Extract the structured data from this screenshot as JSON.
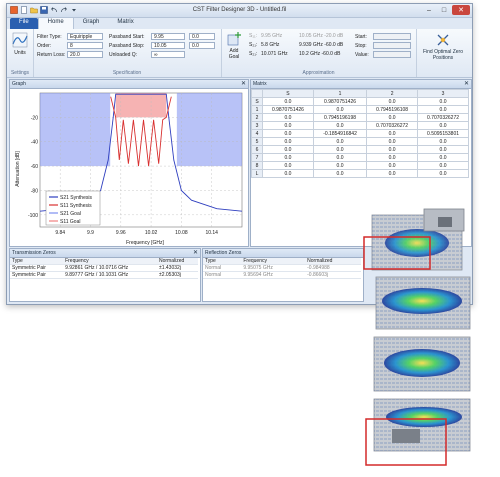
{
  "app": {
    "title": "CST Filter Designer 3D - Untitled.fil",
    "tabs": [
      "File",
      "Home",
      "Graph",
      "Matrix"
    ]
  },
  "ribbon": {
    "units_label": "Units",
    "settings_label": "Settings",
    "spec_label": "Specification",
    "approx_label": "Approximation",
    "filter_type_label": "Filter Type:",
    "filter_type_value": "Equiripple",
    "order_label": "Order:",
    "order_value": "8",
    "return_loss_label": "Return Loss:",
    "return_loss_value": "20.0",
    "pb_start_label": "Passband Start:",
    "pb_start_value": "9.95",
    "pb_stop_label": "Passband Stop:",
    "pb_stop_value": "10.05",
    "unloaded_q_label": "Unloaded Q:",
    "unloaded_q_value": "∞",
    "offset1": "0.0",
    "offset2": "0.0",
    "add_goal_label": "Add Goal",
    "s1_label": "S₁₁:",
    "s1_freq": "9.95 GHz",
    "s1_val": "10.05 GHz  -20.0 dB",
    "s2_label": "S₂₁:",
    "s2_freq": "5.8 GHz",
    "s2_val": "9.939 GHz  -60.0 dB",
    "s3_label": "S₂₁:",
    "s3_freq": "10.071 GHz",
    "s3_val": "10.2 GHz  -60.0 dB",
    "start_label": "Start:",
    "stop_label": "Stop:",
    "value_label": "Value:",
    "find_optimal_label": "Find Optimal Zero Positions"
  },
  "graph": {
    "panel_title": "Graph",
    "legend": [
      "S21 Synthesis",
      "S11 Synthesis",
      "S21 Goal",
      "S11 Goal"
    ],
    "xlabel": "Frequency [GHz]",
    "ylabel": "Attenuation [dB]"
  },
  "chart_data": {
    "type": "line",
    "xlabel": "Frequency [GHz]",
    "ylabel": "Attenuation [dB]",
    "xlim": [
      9.8,
      10.2
    ],
    "ylim": [
      -110,
      0
    ],
    "xticks": [
      "9.84",
      "9.9",
      "9.96",
      "10.02",
      "10.08",
      "10.14"
    ],
    "yticks": [
      "-20",
      "-40",
      "-60",
      "-80",
      "-100"
    ],
    "series": [
      {
        "name": "S21 Synthesis",
        "color": "#2f3fbf",
        "x": [
          9.8,
          9.85,
          9.9,
          9.92,
          9.935,
          9.945,
          9.95,
          10.05,
          10.055,
          10.065,
          10.08,
          10.1,
          10.15,
          10.2
        ],
        "y": [
          -97,
          -95,
          -88,
          -80,
          -55,
          -20,
          -1,
          -1,
          -20,
          -55,
          -80,
          -88,
          -95,
          -97
        ]
      },
      {
        "name": "S11 Synthesis",
        "color": "#d83030",
        "x": [
          9.94,
          9.95,
          9.957,
          9.965,
          9.975,
          9.985,
          9.995,
          10.005,
          10.015,
          10.025,
          10.035,
          10.043,
          10.05,
          10.06
        ],
        "y": [
          -3,
          -20,
          -55,
          -22,
          -58,
          -22,
          -60,
          -22,
          -60,
          -22,
          -58,
          -22,
          -20,
          -3
        ]
      }
    ],
    "goals": {
      "S21 Goal": {
        "color": "#7d8ff0",
        "regions": [
          [
            9.8,
            9.939,
            -60
          ],
          [
            10.071,
            10.2,
            -60
          ]
        ]
      },
      "S11 Goal": {
        "color": "#f08080",
        "regions": [
          [
            9.95,
            10.05,
            -20
          ]
        ]
      }
    }
  },
  "matrix": {
    "panel_title": "Matrix",
    "col_headers": [
      "S",
      "1",
      "2",
      "3"
    ],
    "rows": [
      [
        "S",
        "0.0",
        "0.9870751426",
        "0.0",
        "0.0"
      ],
      [
        "1",
        "0.9870751426",
        "0.0",
        "0.7945196108",
        "0.0"
      ],
      [
        "2",
        "0.0",
        "0.7945196198",
        "0.0",
        "0.7070326272"
      ],
      [
        "3",
        "0.0",
        "0.0",
        "0.7070326272",
        "0.0"
      ],
      [
        "4",
        "0.0",
        "-0.1854916842",
        "0.0",
        "0.5095153801"
      ],
      [
        "5",
        "0.0",
        "0.0",
        "0.0",
        "0.0"
      ],
      [
        "6",
        "0.0",
        "0.0",
        "0.0",
        "0.0"
      ],
      [
        "7",
        "0.0",
        "0.0",
        "0.0",
        "0.0"
      ],
      [
        "8",
        "0.0",
        "0.0",
        "0.0",
        "0.0"
      ],
      [
        "L",
        "0.0",
        "0.0",
        "0.0",
        "0.0"
      ]
    ]
  },
  "transmission": {
    "panel_title": "Transmission Zeros",
    "headers": [
      "Type",
      "Frequency",
      "Normalized"
    ],
    "rows": [
      [
        "Symmetric Pair",
        "9.92861 GHz / 10.0716 GHz",
        "±1.43032j"
      ],
      [
        "Symmetric Pair",
        "9.89777 GHz / 10.1031 GHz",
        "±2.05303j"
      ]
    ]
  },
  "reflection": {
    "panel_title": "Reflection Zeros",
    "headers": [
      "Type",
      "Frequency",
      "Normalized"
    ],
    "rows": [
      [
        "Normal",
        "9.95075 GHz",
        "-0.984988"
      ],
      [
        "Normal",
        "9.95694 GHz",
        "-0.86603j"
      ]
    ]
  }
}
